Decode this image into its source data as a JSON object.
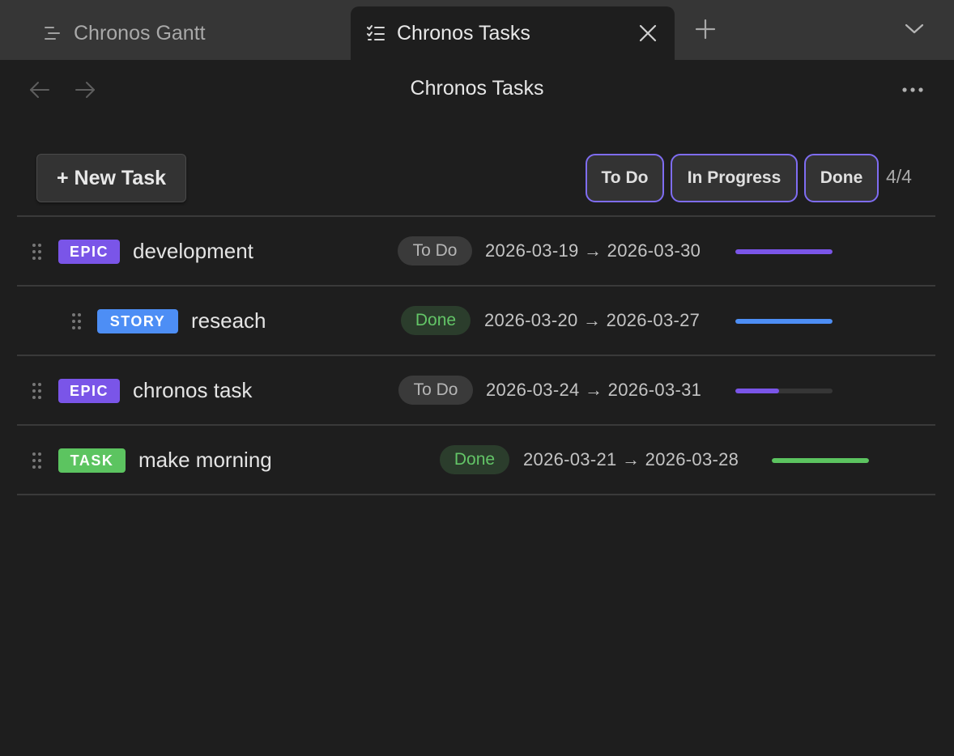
{
  "tabs": [
    {
      "label": "Chronos Gantt",
      "icon": "gantt-lines-icon",
      "active": false
    },
    {
      "label": "Chronos Tasks",
      "icon": "task-list-icon",
      "active": true
    }
  ],
  "header": {
    "title": "Chronos Tasks"
  },
  "toolbar": {
    "new_task_label": "+ New Task",
    "filters": [
      "To Do",
      "In Progress",
      "Done"
    ],
    "count": "4/4"
  },
  "colors": {
    "accent": "#7f6df2",
    "epic": "#7a55e8",
    "story": "#4d8ef5",
    "task": "#5cc460",
    "done_text": "#63c567"
  },
  "tasks": [
    {
      "type": "EPIC",
      "title": "development",
      "status": "To Do",
      "dates": "2026-03-19 → 2026-03-30",
      "progress": 1.0,
      "indent": 0
    },
    {
      "type": "STORY",
      "title": "reseach",
      "status": "Done",
      "dates": "2026-03-20 → 2026-03-27",
      "progress": 1.0,
      "indent": 1
    },
    {
      "type": "EPIC",
      "title": "chronos task",
      "status": "To Do",
      "dates": "2026-03-24 → 2026-03-31",
      "progress": 0.45,
      "indent": 0
    },
    {
      "type": "TASK",
      "title": "make morning",
      "status": "Done",
      "dates": "2026-03-21 → 2026-03-28",
      "progress": 1.0,
      "indent": 0
    }
  ]
}
